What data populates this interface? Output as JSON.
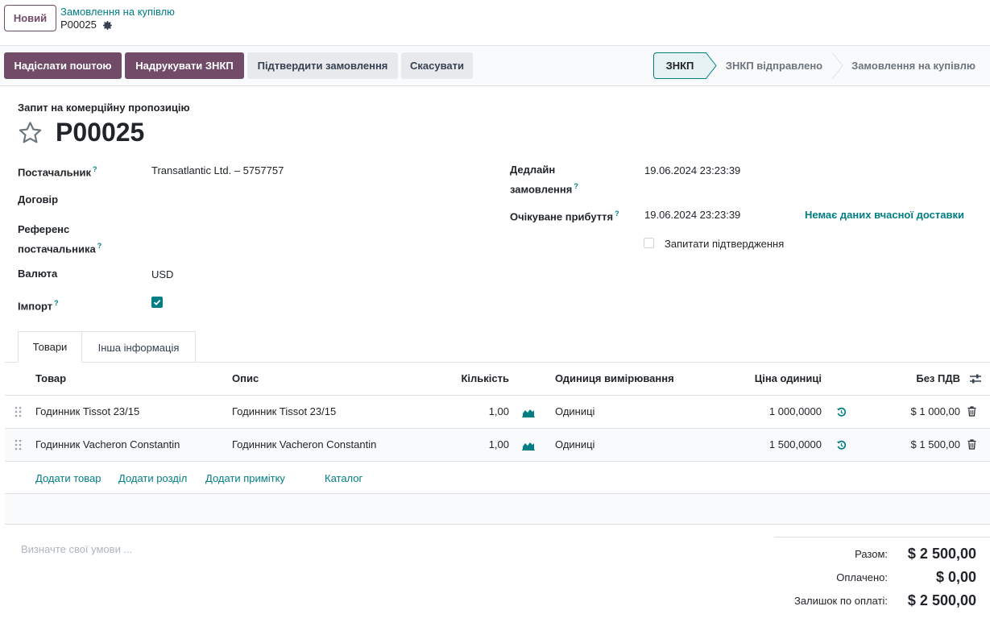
{
  "topbar": {
    "new_label": "Новий",
    "breadcrumb_parent": "Замовлення на купівлю",
    "breadcrumb_current": "P00025"
  },
  "actions": {
    "send_email": "Надіслати поштою",
    "print_rfq": "Надрукувати ЗНКП",
    "confirm_order": "Підтвердити замовлення",
    "cancel": "Скасувати"
  },
  "statusbar": {
    "steps": [
      "ЗНКП",
      "ЗНКП відправлено",
      "Замовлення на купівлю"
    ],
    "active": "ЗНКП"
  },
  "form": {
    "subtitle": "Запит на комерційну пропозицію",
    "name": "P00025",
    "vendor_label": "Постачальник",
    "vendor_value": "Transatlantic Ltd. – 5757757",
    "contract_label": "Договір",
    "vendor_ref_label_1": "Референс",
    "vendor_ref_label_2": "постачальника",
    "currency_label": "Валюта",
    "currency_value": "USD",
    "import_label": "Імпорт",
    "import_checked": true,
    "deadline_label_1": "Дедлайн",
    "deadline_label_2": "замовлення",
    "deadline_value": "19.06.2024 23:23:39",
    "arrival_label": "Очікуване прибуття",
    "arrival_value": "19.06.2024 23:23:39",
    "on_time_link": "Немає даних вчасної доставки",
    "ask_confirm_label": "Запитати підтвердження",
    "help_mark": "?"
  },
  "tabs": [
    "Товари",
    "Інша інформація"
  ],
  "table": {
    "headers": {
      "product": "Товар",
      "description": "Опис",
      "quantity": "Кількість",
      "uom": "Одиниця вимірювання",
      "unit_price": "Ціна одиниці",
      "subtotal": "Без ПДВ"
    },
    "rows": [
      {
        "product": "Годинник Tissot 23/15",
        "description": "Годинник Tissot 23/15",
        "quantity": "1,00",
        "uom": "Одиниці",
        "unit_price": "1 000,0000",
        "subtotal": "$ 1 000,00"
      },
      {
        "product": "Годинник Vacheron Constantin",
        "description": "Годинник Vacheron Constantin",
        "quantity": "1,00",
        "uom": "Одиниці",
        "unit_price": "1 500,0000",
        "subtotal": "$ 1 500,00"
      }
    ],
    "add_product": "Додати товар",
    "add_section": "Додати розділ",
    "add_note": "Додати примітку",
    "catalog": "Каталог"
  },
  "terms_placeholder": "Визначте свої умови ...",
  "totals": {
    "total_label": "Разом:",
    "total_value": "$ 2 500,00",
    "paid_label": "Оплачено:",
    "paid_value": "$ 0,00",
    "due_label": "Залишок по оплаті:",
    "due_value": "$ 2 500,00"
  },
  "colors": {
    "primary": "#714b67",
    "link": "#017e84"
  }
}
